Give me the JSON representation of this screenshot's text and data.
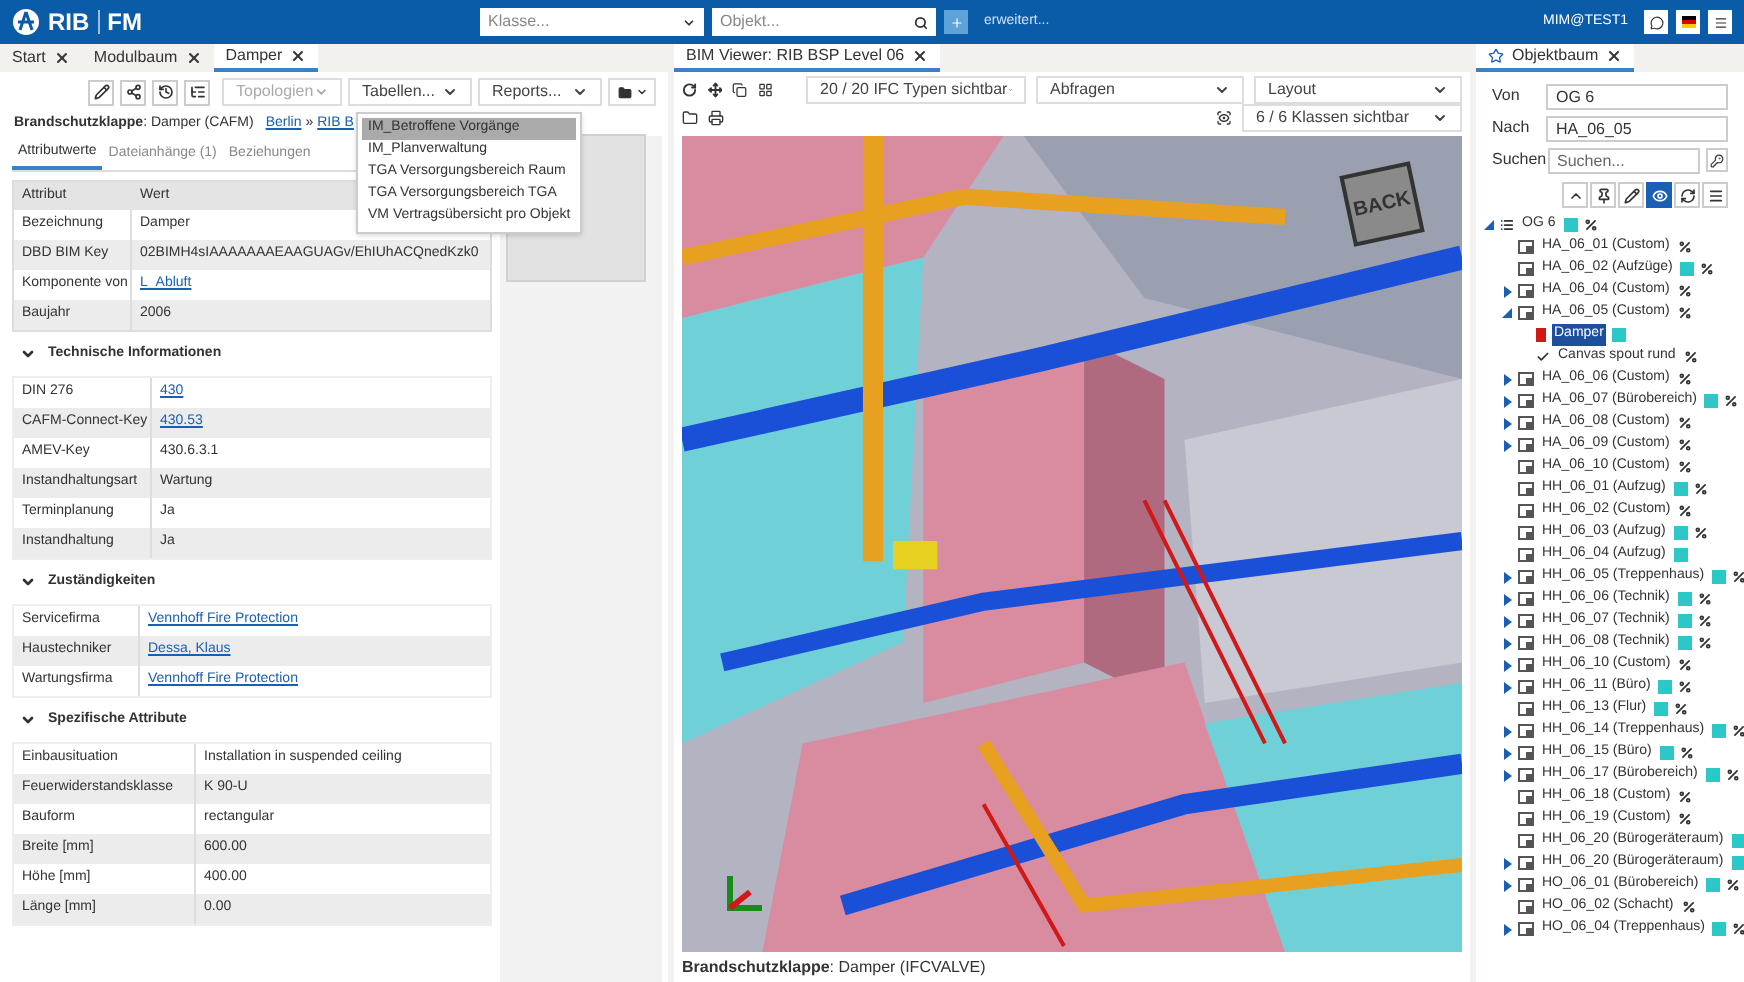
{
  "header": {
    "logo": "RIB",
    "product": "FM",
    "class_select": {
      "placeholder": "Klasse..."
    },
    "object_search": {
      "placeholder": "Objekt..."
    },
    "advanced_link": "erweitert...",
    "user": "MIM@TEST1"
  },
  "left_panel": {
    "tabs": [
      {
        "label": "Start",
        "selected": false
      },
      {
        "label": "Modulbaum",
        "selected": false
      },
      {
        "label": "Damper",
        "selected": true
      }
    ],
    "selects": [
      {
        "label": "Topologien",
        "disabled": true
      },
      {
        "label": "Tabellen...",
        "disabled": false
      },
      {
        "label": "Reports...",
        "disabled": false
      }
    ],
    "title": "**Brandschutzklappe**: Damper (CAFM)",
    "breadcrumb": {
      "items": [
        "Berlin",
        "RIB B"
      ],
      "separator": "»"
    },
    "subtabs": [
      {
        "label": "Attributwerte",
        "selected": true
      },
      {
        "label": "Dateianhänge (1)",
        "selected": false
      },
      {
        "label": "Beziehungen",
        "selected": false
      }
    ],
    "attributes": {
      "columns": [
        "Attribut",
        "Wert"
      ],
      "rows": [
        {
          "label": "Bezeichnung",
          "value": "Damper",
          "link": false
        },
        {
          "label": "DBD BIM Key",
          "value": "02BIMH4sIAAAAAAAEAAGUAGv/EhIUhACQnedKzk0",
          "link": false
        },
        {
          "label": "Komponente von",
          "value": "L_Abluft",
          "link": true
        },
        {
          "label": "Baujahr",
          "value": "2006",
          "link": false
        }
      ]
    },
    "sections": [
      {
        "title": "Technische Informationen",
        "expanded": true,
        "rows": [
          {
            "label": "DIN 276",
            "value": "430",
            "link": true
          },
          {
            "label": "CAFM-Connect-Key",
            "value": "430.53",
            "link": true
          },
          {
            "label": "AMEV-Key",
            "value": "430.6.3.1",
            "link": false
          },
          {
            "label": "Instandhaltungsart",
            "value": "Wartung",
            "link": false
          },
          {
            "label": "Terminplanung",
            "value": "Ja",
            "link": false
          },
          {
            "label": "Instandhaltung",
            "value": "Ja",
            "link": false
          }
        ]
      },
      {
        "title": "Zuständigkeiten",
        "expanded": true,
        "rows": [
          {
            "label": "Servicefirma",
            "value": "Vennhoff Fire Protection",
            "link": true
          },
          {
            "label": "Haustechniker",
            "value": "Dessa, Klaus",
            "link": true
          },
          {
            "label": "Wartungsfirma",
            "value": "Vennhoff Fire Protection",
            "link": true
          }
        ]
      },
      {
        "title": "Spezifische Attribute",
        "expanded": true,
        "rows": [
          {
            "label": "Einbausituation",
            "value": "Installation in suspended ceiling",
            "link": false
          },
          {
            "label": "Feuerwiderstandsklasse",
            "value": "K 90-U",
            "link": false
          },
          {
            "label": "Bauform",
            "value": "rectangular",
            "link": false
          },
          {
            "label": "Breite [mm]",
            "value": "600.00",
            "link": false
          },
          {
            "label": "Höhe [mm]",
            "value": "400.00",
            "link": false
          },
          {
            "label": "Länge [mm]",
            "value": "0.00",
            "link": false
          }
        ]
      }
    ],
    "tables_menu": {
      "items": [
        {
          "label": "IM_Betroffene Vorgänge",
          "selected": true
        },
        {
          "label": "IM_Planverwaltung",
          "selected": false
        },
        {
          "label": "TGA Versorgungsbereich Raum",
          "selected": false
        },
        {
          "label": "TGA Versorgungsbereich TGA",
          "selected": false
        },
        {
          "label": "VM Vertragsübersicht pro Objekt",
          "selected": false
        }
      ]
    }
  },
  "viewer": {
    "tab": "BIM Viewer: RIB BSP Level 06",
    "selects": [
      "20 / 20 IFC Typen sichtbar",
      "Abfragen",
      "Layout",
      "6 / 6 Klassen sichtbar"
    ],
    "view_cube": "BACK",
    "caption": "**Brandschutzklappe**: Damper (IFCVALVE)"
  },
  "tree_panel": {
    "tab": "Objektbaum",
    "from": {
      "label": "Von",
      "value": "OG 6"
    },
    "to": {
      "label": "Nach",
      "value": "HA_06_05"
    },
    "search": {
      "label": "Suchen",
      "placeholder": "Suchen..."
    },
    "tools": [
      {
        "selected": false
      },
      {
        "selected": false
      },
      {
        "selected": false
      },
      {
        "selected": true
      },
      {
        "selected": false
      },
      {
        "selected": false
      }
    ],
    "tree": [
      {
        "label": "OG 6",
        "kind": "floor",
        "expanded": true,
        "shaded": true,
        "percent": true,
        "selected": false,
        "children": [
          {
            "label": "HA_06_01 (Custom)",
            "kind": "space",
            "shaded": false,
            "percent": true,
            "selected": false
          },
          {
            "label": "HA_06_02 (Aufzüge)",
            "kind": "space",
            "shaded": true,
            "percent": true,
            "selected": false
          },
          {
            "label": "HA_06_04 (Custom)",
            "kind": "space",
            "expanded": false,
            "shaded": false,
            "percent": true,
            "selected": false
          },
          {
            "label": "HA_06_05 (Custom)",
            "kind": "space",
            "expanded": true,
            "shaded": false,
            "percent": true,
            "selected": false,
            "children": [
              {
                "label": "Damper",
                "kind": "component",
                "shaded": true,
                "percent": false,
                "selected": true
              },
              {
                "label": "Canvas spout rund",
                "kind": "part",
                "shaded": false,
                "percent": true,
                "selected": false
              }
            ]
          },
          {
            "label": "HA_06_06 (Custom)",
            "kind": "space",
            "expanded": false,
            "shaded": false,
            "percent": true,
            "selected": false
          },
          {
            "label": "HA_06_07 (Bürobereich)",
            "kind": "space",
            "expanded": false,
            "shaded": true,
            "percent": true,
            "selected": false
          },
          {
            "label": "HA_06_08 (Custom)",
            "kind": "space",
            "expanded": false,
            "shaded": false,
            "percent": true,
            "selected": false
          },
          {
            "label": "HA_06_09 (Custom)",
            "kind": "space",
            "expanded": false,
            "shaded": false,
            "percent": true,
            "selected": false
          },
          {
            "label": "HA_06_10 (Custom)",
            "kind": "space",
            "shaded": false,
            "percent": true,
            "selected": false
          },
          {
            "label": "HH_06_01 (Aufzug)",
            "kind": "space",
            "shaded": true,
            "percent": true,
            "selected": false
          },
          {
            "label": "HH_06_02 (Custom)",
            "kind": "space",
            "shaded": false,
            "percent": true,
            "selected": false
          },
          {
            "label": "HH_06_03 (Aufzug)",
            "kind": "space",
            "shaded": true,
            "percent": true,
            "selected": false
          },
          {
            "label": "HH_06_04 (Aufzug)",
            "kind": "space",
            "shaded": true,
            "percent": false,
            "selected": false
          },
          {
            "label": "HH_06_05 (Treppenhaus)",
            "kind": "space",
            "expanded": false,
            "shaded": true,
            "percent": true,
            "selected": false
          },
          {
            "label": "HH_06_06 (Technik)",
            "kind": "space",
            "expanded": false,
            "shaded": true,
            "percent": true,
            "selected": false
          },
          {
            "label": "HH_06_07 (Technik)",
            "kind": "space",
            "expanded": false,
            "shaded": true,
            "percent": true,
            "selected": false
          },
          {
            "label": "HH_06_08 (Technik)",
            "kind": "space",
            "expanded": false,
            "shaded": true,
            "percent": true,
            "selected": false
          },
          {
            "label": "HH_06_10 (Custom)",
            "kind": "space",
            "expanded": false,
            "shaded": false,
            "percent": true,
            "selected": false
          },
          {
            "label": "HH_06_11 (Büro)",
            "kind": "space",
            "expanded": false,
            "shaded": true,
            "percent": true,
            "selected": false
          },
          {
            "label": "HH_06_13 (Flur)",
            "kind": "space",
            "shaded": true,
            "percent": true,
            "selected": false
          },
          {
            "label": "HH_06_14 (Treppenhaus)",
            "kind": "space",
            "expanded": false,
            "shaded": true,
            "percent": true,
            "selected": false
          },
          {
            "label": "HH_06_15 (Büro)",
            "kind": "space",
            "expanded": false,
            "shaded": true,
            "percent": true,
            "selected": false
          },
          {
            "label": "HH_06_17 (Bürobereich)",
            "kind": "space",
            "expanded": false,
            "shaded": true,
            "percent": true,
            "selected": false
          },
          {
            "label": "HH_06_18 (Custom)",
            "kind": "space",
            "shaded": false,
            "percent": true,
            "selected": false
          },
          {
            "label": "HH_06_19 (Custom)",
            "kind": "space",
            "shaded": false,
            "percent": true,
            "selected": false
          },
          {
            "label": "HH_06_20 (Bürogeräteraum)",
            "kind": "space",
            "shaded": true,
            "percent": false,
            "selected": false
          },
          {
            "label": "HH_06_20 (Bürogeräteraum)",
            "kind": "space",
            "expanded": false,
            "shaded": true,
            "percent": false,
            "selected": false
          },
          {
            "label": "HO_06_01 (Bürobereich)",
            "kind": "space",
            "expanded": false,
            "shaded": true,
            "percent": true,
            "selected": false
          },
          {
            "label": "HO_06_02 (Schacht)",
            "kind": "space",
            "shaded": false,
            "percent": true,
            "selected": false
          },
          {
            "label": "HO_06_04 (Treppenhaus)",
            "kind": "space",
            "expanded": false,
            "shaded": true,
            "percent": true,
            "selected": false
          }
        ]
      }
    ]
  }
}
